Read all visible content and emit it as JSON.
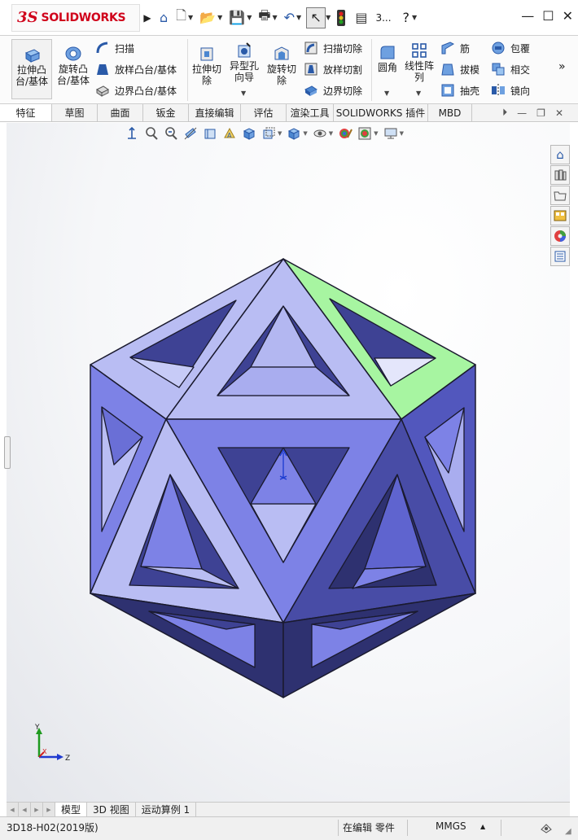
{
  "app": {
    "brand_ds": "3S",
    "brand_word": "SOLIDWORKS",
    "doc_short": "3...",
    "help": "?",
    "window_min": "—",
    "window_max": "☐",
    "window_close": "✕"
  },
  "ribbon": {
    "extrude_boss": [
      "拉伸凸",
      "台/基体"
    ],
    "revolve_boss": [
      "旋转凸",
      "台/基体"
    ],
    "sweep": "扫描",
    "loft_boss": "放样凸台/基体",
    "boundary_boss": "边界凸台/基体",
    "extrude_cut": [
      "拉伸切",
      "除"
    ],
    "hole_wizard": [
      "异型孔",
      "向导"
    ],
    "revolve_cut": [
      "旋转切",
      "除"
    ],
    "sweep_cut": "扫描切除",
    "loft_cut": "放样切割",
    "boundary_cut": "边界切除",
    "fillet": "圆角",
    "linear_pattern": [
      "线性阵",
      "列"
    ],
    "rib": "筋",
    "draft": "拔模",
    "shell": "抽壳",
    "wrap": "包覆",
    "intersect": "相交",
    "mirror": "镜向",
    "more": "»"
  },
  "tabs": [
    "特征",
    "草图",
    "曲面",
    "钣金",
    "直接编辑",
    "评估",
    "渲染工具",
    "SOLIDWORKS 插件",
    "MBD"
  ],
  "bottom_tabs": [
    "模型",
    "3D 视图",
    "运动算例 1"
  ],
  "status": {
    "filename": "3D18-H02(2019版)",
    "mode": "在编辑 零件",
    "units": "MMGS",
    "units_arrow": "▲"
  },
  "triad": {
    "x": "X",
    "y": "Y",
    "z": "Z"
  },
  "colors": {
    "face_light": "#b9bdf3",
    "face_mid": "#7d82e6",
    "face_dark": "#484ca6",
    "face_darkest": "#2e3170",
    "selected_face": "#a7f5a1",
    "brand_red": "#d0021b"
  }
}
